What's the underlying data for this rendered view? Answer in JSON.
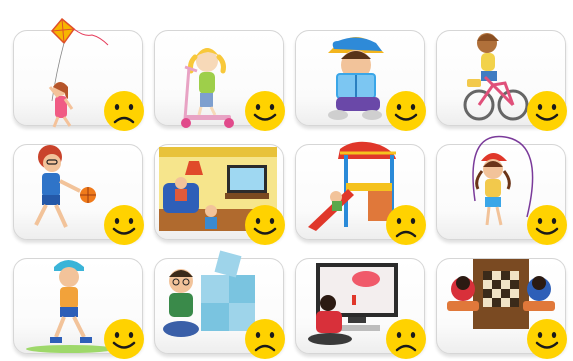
{
  "activity_grid": {
    "cards": [
      {
        "activity": "flying-kite",
        "mood": "sad"
      },
      {
        "activity": "riding-scooter",
        "mood": "happy"
      },
      {
        "activity": "reading-book",
        "mood": "happy"
      },
      {
        "activity": "riding-bicycle",
        "mood": "happy"
      },
      {
        "activity": "playing-basketball",
        "mood": "happy"
      },
      {
        "activity": "watching-tv",
        "mood": "happy"
      },
      {
        "activity": "playground-slide",
        "mood": "sad"
      },
      {
        "activity": "jumping-rope",
        "mood": "happy"
      },
      {
        "activity": "roller-skating",
        "mood": "happy"
      },
      {
        "activity": "jigsaw-puzzle",
        "mood": "sad"
      },
      {
        "activity": "video-game",
        "mood": "sad"
      },
      {
        "activity": "playing-chess",
        "mood": "happy"
      }
    ]
  },
  "colors": {
    "face_fill": "#ffd200",
    "face_features": "#1a1a1a",
    "card_border": "#d6d6d6"
  }
}
